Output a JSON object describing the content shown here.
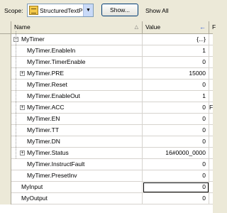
{
  "toolbar": {
    "scope_label": "Scope:",
    "scope_value": "StructuredTextPr",
    "show_button": "Show...",
    "show_all": "Show All"
  },
  "columns": {
    "name": "Name",
    "value": "Value",
    "extra": "F"
  },
  "rows": [
    {
      "name": "MyTimer",
      "value": "{...}",
      "extra": "",
      "level": 0,
      "expander": "minus"
    },
    {
      "name": "MyTimer.EnableIn",
      "value": "1",
      "extra": "",
      "level": 1,
      "expander": ""
    },
    {
      "name": "MyTimer.TimerEnable",
      "value": "0",
      "extra": "",
      "level": 1,
      "expander": ""
    },
    {
      "name": "MyTimer.PRE",
      "value": "15000",
      "extra": "",
      "level": 1,
      "expander": "plus"
    },
    {
      "name": "MyTimer.Reset",
      "value": "0",
      "extra": "",
      "level": 1,
      "expander": ""
    },
    {
      "name": "MyTimer.EnableOut",
      "value": "1",
      "extra": "",
      "level": 1,
      "expander": ""
    },
    {
      "name": "MyTimer.ACC",
      "value": "0",
      "extra": "F",
      "level": 1,
      "expander": "plus"
    },
    {
      "name": "MyTimer.EN",
      "value": "0",
      "extra": "",
      "level": 1,
      "expander": ""
    },
    {
      "name": "MyTimer.TT",
      "value": "0",
      "extra": "",
      "level": 1,
      "expander": ""
    },
    {
      "name": "MyTimer.DN",
      "value": "0",
      "extra": "",
      "level": 1,
      "expander": ""
    },
    {
      "name": "MyTimer.Status",
      "value": "16#0000_0000",
      "extra": "",
      "level": 1,
      "expander": "plus"
    },
    {
      "name": "MyTimer.InstructFault",
      "value": "0",
      "extra": "",
      "level": 1,
      "expander": ""
    },
    {
      "name": "MyTimer.PresetInv",
      "value": "0",
      "extra": "",
      "level": 1,
      "expander": ""
    },
    {
      "name": "MyInput",
      "value": "0",
      "extra": "",
      "level": 0,
      "expander": ""
    },
    {
      "name": "MyOutput",
      "value": "0",
      "extra": "",
      "level": 0,
      "expander": ""
    }
  ]
}
